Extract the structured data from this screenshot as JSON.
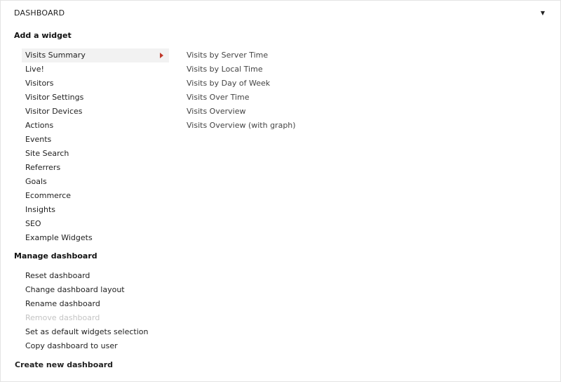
{
  "header": {
    "title": "DASHBOARD",
    "dropdown_glyph": "▼"
  },
  "add_widget": {
    "title": "Add a widget",
    "categories": [
      {
        "label": "Visits Summary",
        "active": true
      },
      {
        "label": "Live!"
      },
      {
        "label": "Visitors"
      },
      {
        "label": "Visitor Settings"
      },
      {
        "label": "Visitor Devices"
      },
      {
        "label": "Actions"
      },
      {
        "label": "Events"
      },
      {
        "label": "Site Search"
      },
      {
        "label": "Referrers"
      },
      {
        "label": "Goals"
      },
      {
        "label": "Ecommerce"
      },
      {
        "label": "Insights"
      },
      {
        "label": "SEO"
      },
      {
        "label": "Example Widgets"
      }
    ],
    "widgets": [
      "Visits by Server Time",
      "Visits by Local Time",
      "Visits by Day of Week",
      "Visits Over Time",
      "Visits Overview",
      "Visits Overview (with graph)"
    ]
  },
  "manage_dashboard": {
    "title": "Manage dashboard",
    "items": [
      {
        "label": "Reset dashboard"
      },
      {
        "label": "Change dashboard layout"
      },
      {
        "label": "Rename dashboard"
      },
      {
        "label": "Remove dashboard",
        "disabled": true
      },
      {
        "label": "Set as default widgets selection"
      },
      {
        "label": "Copy dashboard to user"
      }
    ]
  },
  "create_new": {
    "label": "Create new dashboard"
  },
  "colors": {
    "active_bg": "#f2f2f2",
    "submenu_arrow": "#c0392b",
    "disabled_text": "#c4c4c4"
  }
}
